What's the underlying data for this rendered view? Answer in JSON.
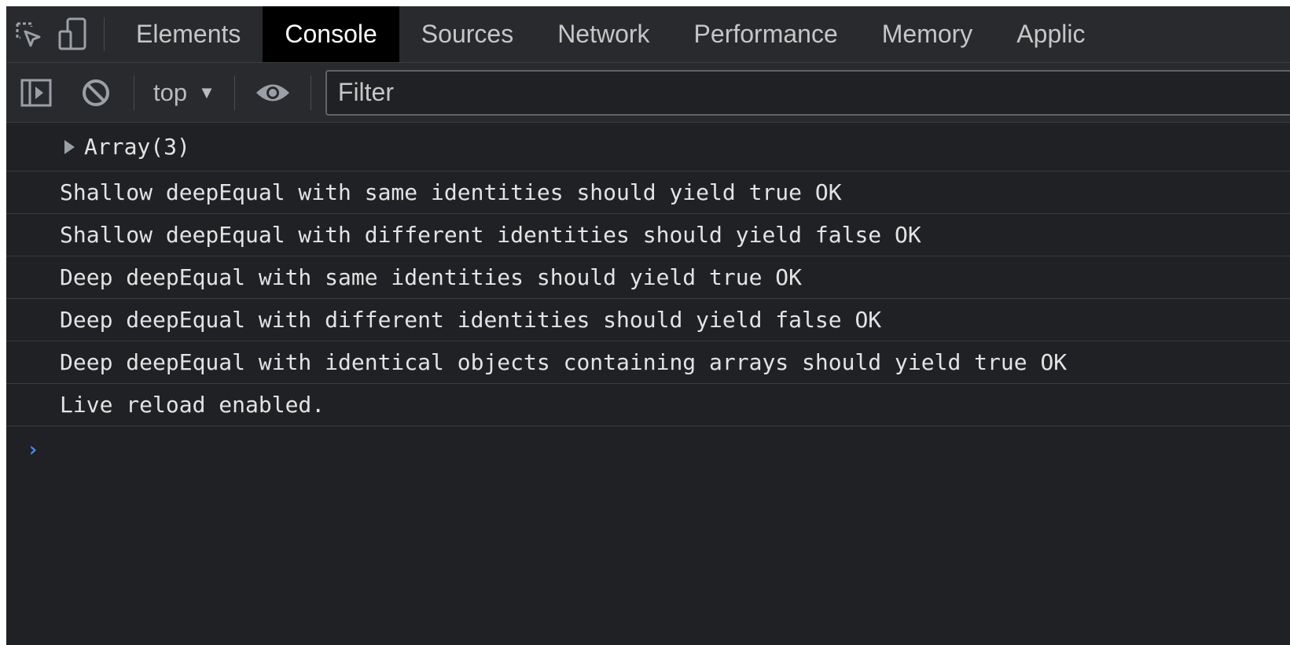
{
  "tabs": [
    {
      "label": "Elements",
      "active": false
    },
    {
      "label": "Console",
      "active": true
    },
    {
      "label": "Sources",
      "active": false
    },
    {
      "label": "Network",
      "active": false
    },
    {
      "label": "Performance",
      "active": false
    },
    {
      "label": "Memory",
      "active": false
    },
    {
      "label": "Applic",
      "active": false
    }
  ],
  "toolbar": {
    "icons": [
      "inspect-element-icon",
      "device-toolbar-icon",
      "sidebar-toggle-icon",
      "clear-console-icon",
      "eye-icon"
    ],
    "context_label": "top",
    "context_arrow": "▼",
    "filter_placeholder": "Filter"
  },
  "console": {
    "entries": [
      "Array(3)",
      "Shallow deepEqual with same identities should yield true OK",
      "Shallow deepEqual with different identities should yield false OK",
      "Deep deepEqual with same identities should yield true OK",
      "Deep deepEqual with different identities should yield false OK",
      "Deep deepEqual with identical objects containing arrays should yield true OK",
      "Live reload enabled."
    ],
    "prompt": "›"
  },
  "colors": {
    "panel_bg": "#202124",
    "toolbar_bg": "#292a2d",
    "active_tab_bg": "#000000",
    "prompt_blue": "#4b8bf4"
  }
}
